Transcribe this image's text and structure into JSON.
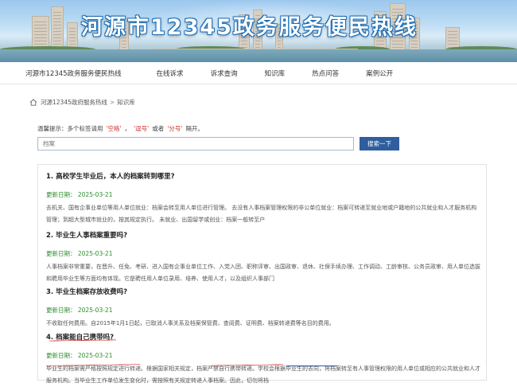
{
  "banner": {
    "title": "河源市12345政务服务便民热线"
  },
  "nav": {
    "items": [
      "河源市12345政务服务便民热线",
      "在线诉求",
      "诉求查询",
      "知识库",
      "热点问答",
      "案例公开"
    ]
  },
  "breadcrumb": {
    "home": "河源12345政府服务热线",
    "sep": ">",
    "current": "知识库",
    "icon": "home-icon"
  },
  "tip": {
    "prefix": "温馨提示：多个标签请用",
    "kw1": "'空格'",
    "comma": "，",
    "kw2": "'逗号'",
    "or": "或者",
    "kw3": "'分号'",
    "suffix": "隔开。"
  },
  "search": {
    "placeholder": "档案",
    "button": "搜索一下"
  },
  "articles": [
    {
      "title": "1. 高校学生毕业后，本人的档案转到哪里?",
      "date": "更新日期： 2025-03-21",
      "body": "去机关、国有企事业单位等用人单位就业：档案会转至用人单位进行管理。 去没有人事档案管理权限的非公单位就业：档案可转递至就业地或户籍地的公共就业和人才服务机构管理；到超大型城市就业的，按其规定执行。 未就业、出国留学或创业：档案一般转至户"
    },
    {
      "title": "2. 毕业生人事档案重要吗?",
      "date": "更新日期： 2025-03-21",
      "body": "人事档案非常重要，在晋升、任免、考研、进入国有企事业单位工作、入党入团、职称评审、出国政审、退休、社保手续办理、工作调动、工龄审核、公务员政审、用人单位选拔和聘用毕业生等方面均有体现。它是聘任用人单位录用、培养、使用人才，以及组织人事部门"
    },
    {
      "title": "3. 毕业生档案存放收费吗?",
      "date": "更新日期： 2025-03-21",
      "body": "不收取任何费用。自2015年1月1日起，已取消人事关系及档案保管费、查阅费、证明费、档案转递费等名目的费用。"
    },
    {
      "title": "4. 档案能自己携带吗?",
      "date": "更新日期： 2025-03-21",
      "body": "毕业生的档案需严格按照规定进行转递。根据国家相关规定，档案严禁自行携带转递。学校会根据毕业生的去向，将档案转至有人事管理权限的用人单位或相应的公共就业和人才服务机构。当毕业生工作单位发生变化时，需按照有关规定转递人事档案。因此，切勿将档"
    }
  ],
  "colors": {
    "nav_border": "#e6e6e6",
    "search_button": "#2f5e9e",
    "date_green": "#2c8c2c",
    "tip_keyword": "#c9302c",
    "annot_red": "#d23a3a",
    "annot_blue": "#2f57b5"
  }
}
